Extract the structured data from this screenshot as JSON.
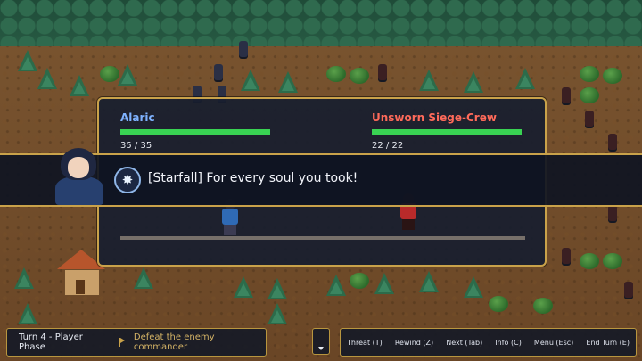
{
  "battle": {
    "ally": {
      "name": "Alaric",
      "hp_current": 35,
      "hp_max": 35,
      "hp_text": "35 / 35",
      "hp_fraction": 1.0
    },
    "enemy": {
      "name": "Unsworn Siege-Crew",
      "hp_current": 22,
      "hp_max": 22,
      "hp_text": "22 / 22",
      "hp_fraction": 1.0
    }
  },
  "dialogue": {
    "skill_icon": "starburst-icon",
    "skill_name": "[Starfall]",
    "line": "For every soul you took!"
  },
  "hud": {
    "phase": "Turn 4 - Player Phase",
    "objective": "Defeat the enemy commander",
    "commands": [
      {
        "label": "Threat (T)"
      },
      {
        "label": "Rewind (Z)"
      },
      {
        "label": "Next (Tab)"
      },
      {
        "label": "Info (C)"
      },
      {
        "label": "Menu (Esc)"
      },
      {
        "label": "End Turn (E)"
      }
    ]
  },
  "colors": {
    "gold_border": "#c9a24a",
    "hp_green": "#39d353",
    "ally_name": "#7fb2ff",
    "enemy_name": "#ff6a5a"
  }
}
